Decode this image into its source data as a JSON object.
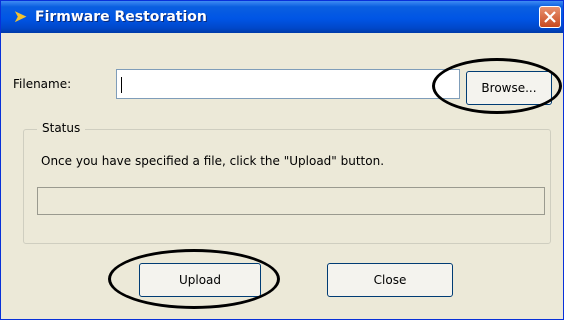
{
  "window": {
    "title": "Firmware Restoration",
    "app_icon": "arrow-icon",
    "close_icon": "close-icon"
  },
  "form": {
    "filename_label": "Filename:",
    "filename_value": "",
    "browse_label": "Browse..."
  },
  "status": {
    "group_label": "Status",
    "message": "Once you have specified a file, click the \"Upload\" button.",
    "progress": 0
  },
  "buttons": {
    "upload_label": "Upload",
    "close_label": "Close"
  },
  "colors": {
    "titlebar": "#0055e5",
    "dialog_background": "#ece9d8",
    "close_button": "#d9622f",
    "annotation": "#000000"
  }
}
